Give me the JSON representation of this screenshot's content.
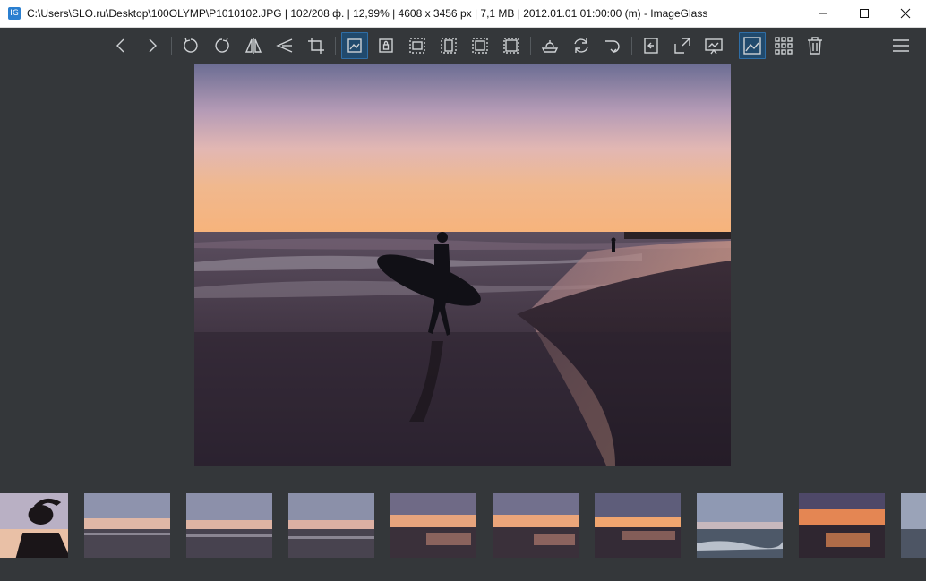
{
  "window": {
    "title": "C:\\Users\\SLO.ru\\Desktop\\100OLYMP\\P1010102.JPG  |  102/208 ф.  |  12,99%  |  4608 x 3456 px  |  7,1 MB  |  2012.01.01 01:00:00 (m)  - ImageGlass",
    "app_icon_text": "IG",
    "controls": [
      "minimize-icon",
      "maximize-icon",
      "close-icon"
    ]
  },
  "toolbar": {
    "buttons": [
      {
        "icon": "previous-icon"
      },
      {
        "icon": "next-icon"
      },
      {
        "icon": "rotate-left-icon"
      },
      {
        "icon": "rotate-right-icon"
      },
      {
        "icon": "flip-horizontal-icon"
      },
      {
        "icon": "flip-vertical-icon"
      },
      {
        "icon": "crop-icon"
      },
      {
        "icon": "auto-zoom-icon",
        "active": true
      },
      {
        "icon": "lock-zoom-icon"
      },
      {
        "icon": "scale-to-width-icon"
      },
      {
        "icon": "scale-to-height-icon"
      },
      {
        "icon": "scale-to-fit-icon"
      },
      {
        "icon": "scale-to-fill-icon"
      },
      {
        "icon": "checkerboard-icon"
      },
      {
        "icon": "refresh-icon"
      },
      {
        "icon": "goto-image-icon"
      },
      {
        "icon": "window-fit-icon"
      },
      {
        "icon": "fullscreen-icon"
      },
      {
        "icon": "slideshow-icon"
      },
      {
        "icon": "thumbnail-bar-icon",
        "active": true
      },
      {
        "icon": "gallery-grid-icon"
      },
      {
        "icon": "delete-icon"
      }
    ],
    "menu_icon": "menu-icon"
  },
  "viewer": {
    "image_description_icon": "photo-surfer-sunset"
  },
  "thumbnails": [
    {
      "name": "thumb-silhouette"
    },
    {
      "name": "thumb-beach-dusk-1"
    },
    {
      "name": "thumb-beach-dusk-2"
    },
    {
      "name": "thumb-beach-dusk-3"
    },
    {
      "name": "thumb-beach-sunset-1"
    },
    {
      "name": "thumb-beach-sunset-2"
    },
    {
      "name": "thumb-beach-sunset-3"
    },
    {
      "name": "thumb-beach-waves"
    },
    {
      "name": "thumb-beach-orange"
    },
    {
      "name": "thumb-partial"
    }
  ],
  "colors": {
    "background": "#34373a",
    "active_button": "#214a6d",
    "icon_stroke": "#cfd2d5"
  }
}
